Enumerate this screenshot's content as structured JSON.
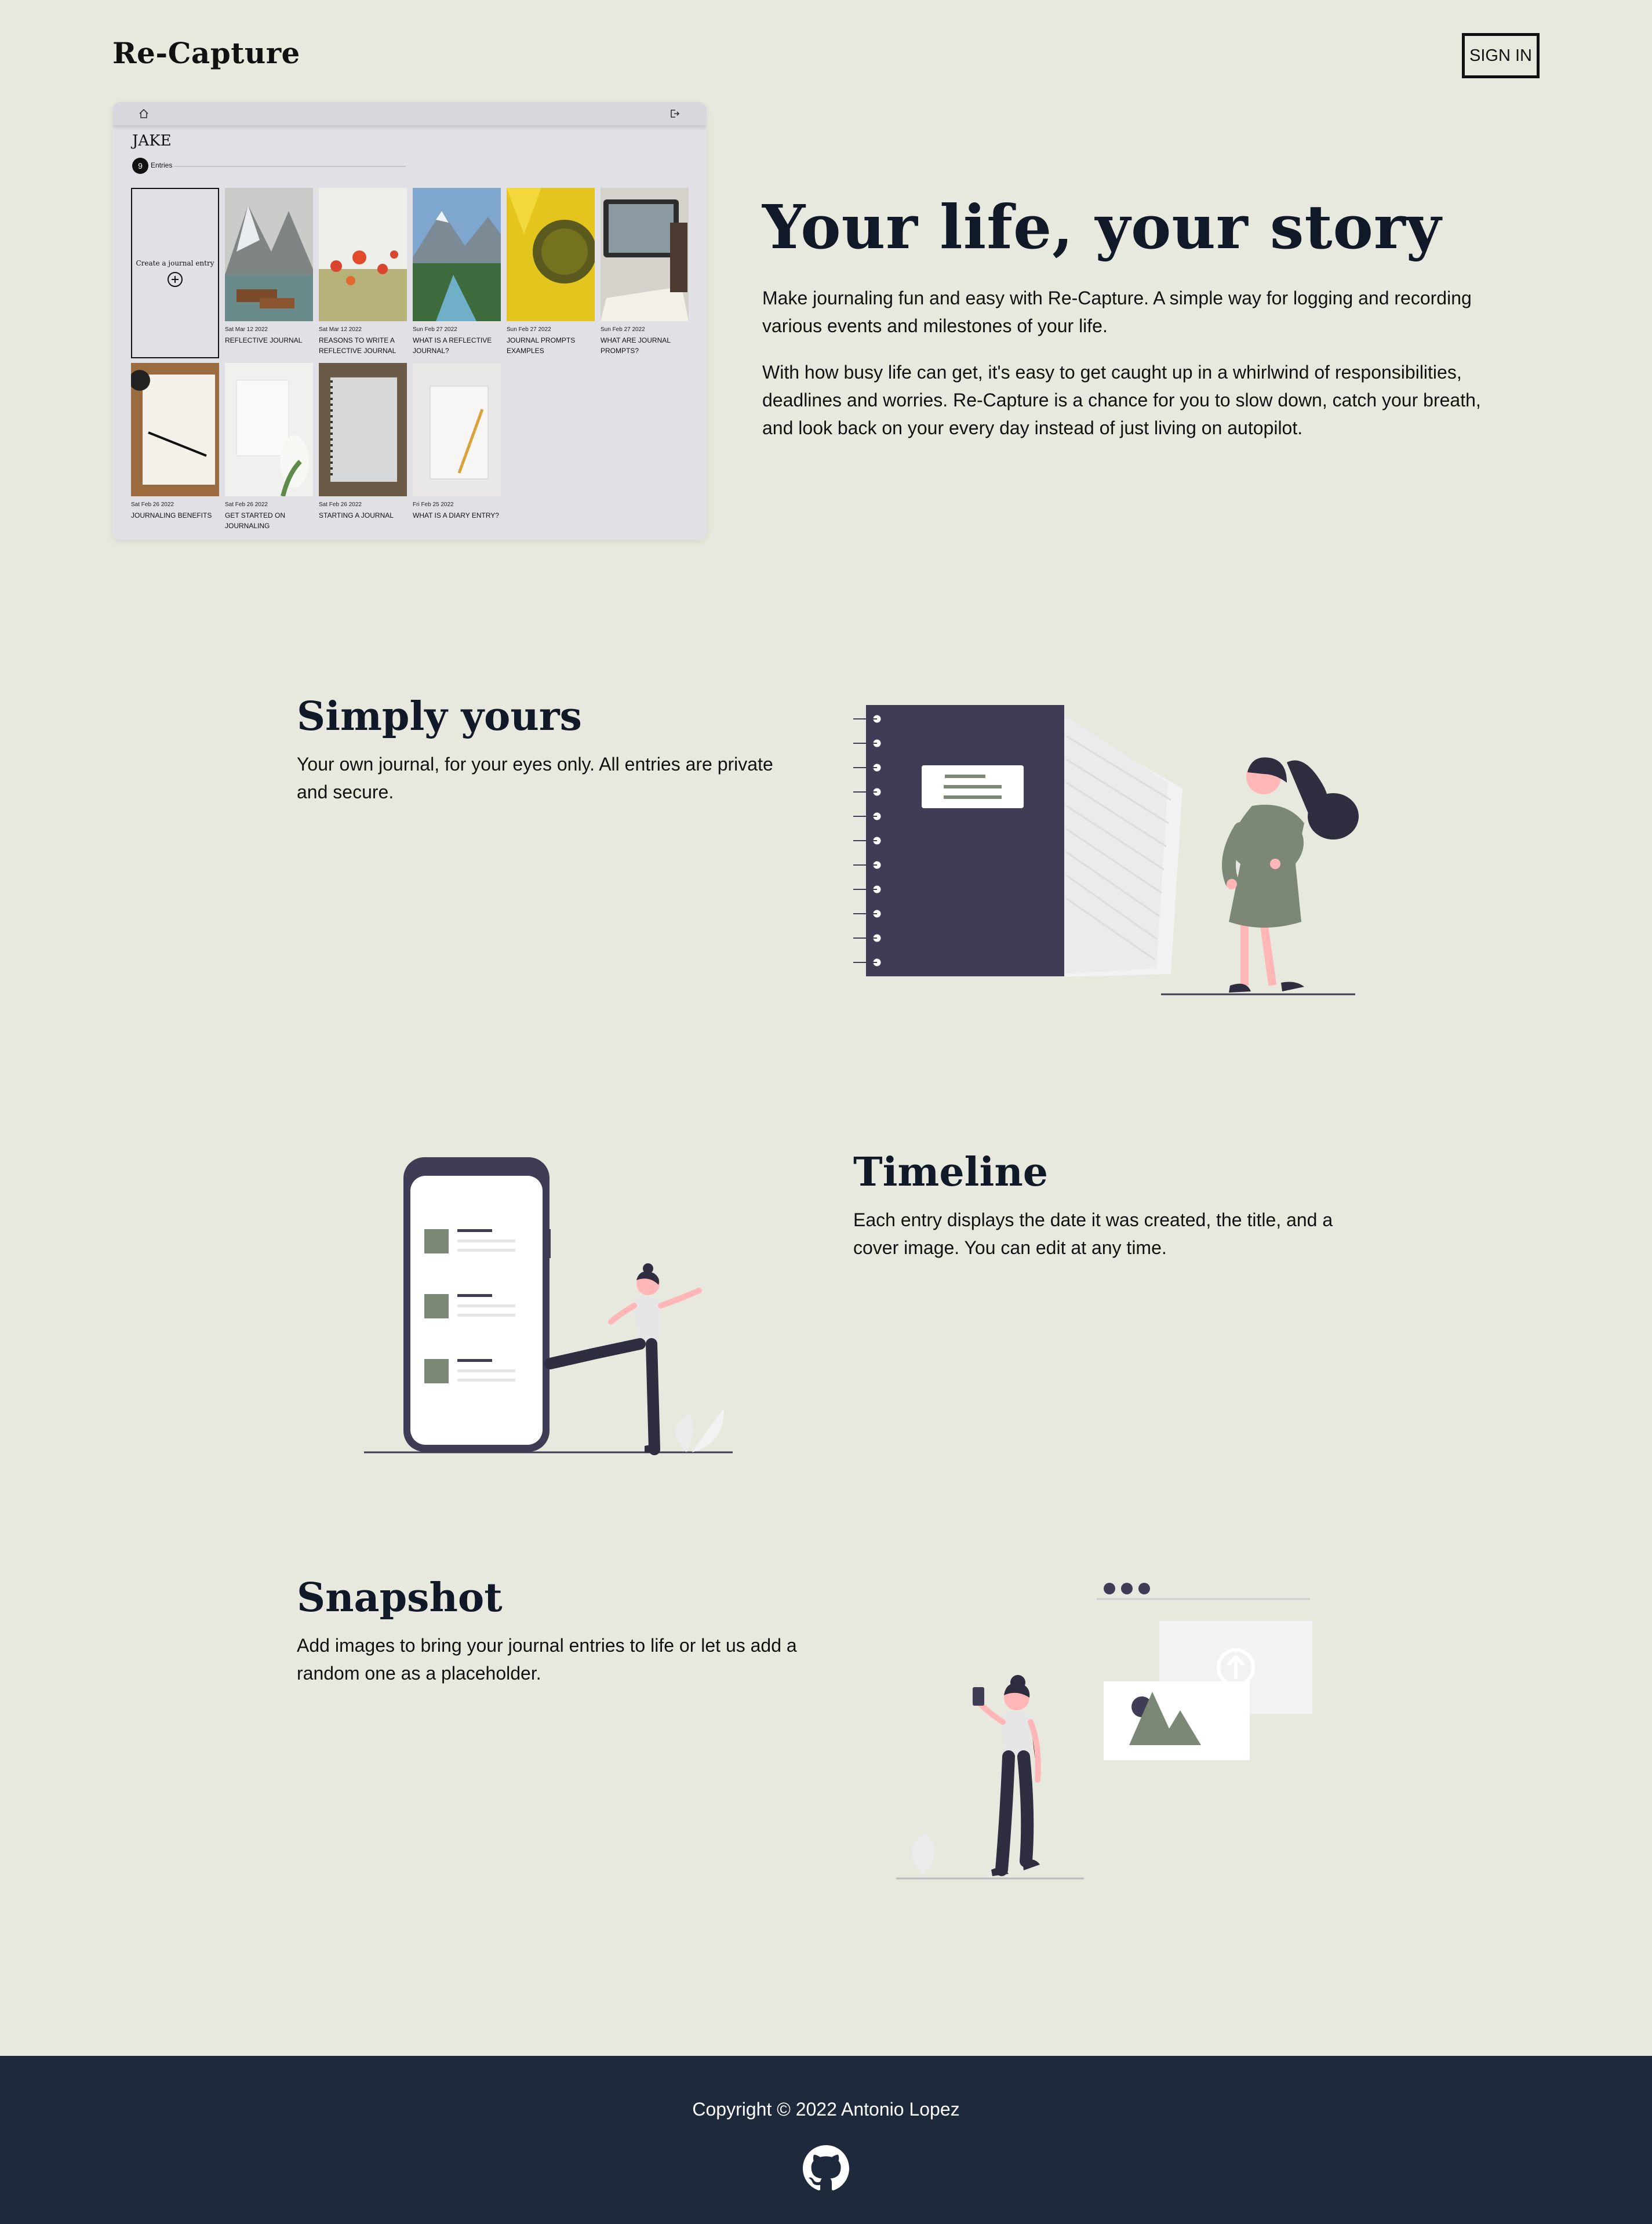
{
  "header": {
    "logo": "Re-Capture",
    "signin_label": "SIGN IN"
  },
  "preview": {
    "username": "JAKE",
    "entries_count": "9",
    "entries_label": "Entries",
    "create_label": "Create a journal entry",
    "cards": [
      {
        "date": "Sat Mar 12 2022",
        "title": "REFLECTIVE JOURNAL"
      },
      {
        "date": "Sat Mar 12 2022",
        "title": "REASONS TO WRITE A REFLECTIVE JOURNAL"
      },
      {
        "date": "Sun Feb 27 2022",
        "title": "WHAT IS A REFLECTIVE JOURNAL?"
      },
      {
        "date": "Sun Feb 27 2022",
        "title": "JOURNAL PROMPTS EXAMPLES"
      },
      {
        "date": "Sun Feb 27 2022",
        "title": "WHAT ARE JOURNAL PROMPTS?"
      },
      {
        "date": "Sat Feb 26 2022",
        "title": "JOURNALING BENEFITS"
      },
      {
        "date": "Sat Feb 26 2022",
        "title": "GET STARTED ON JOURNALING"
      },
      {
        "date": "Sat Feb 26 2022",
        "title": "STARTING A JOURNAL"
      },
      {
        "date": "Fri Feb 25 2022",
        "title": "WHAT IS A DIARY ENTRY?"
      }
    ]
  },
  "hero": {
    "title": "Your life, your story",
    "p1": "Make journaling fun and easy with Re-Capture. A simple way for logging and recording various events and milestones of your life.",
    "p2": "With how busy life can get, it's easy to get caught up in a whirlwind of responsibilities, deadlines and worries. Re-Capture is a chance for you to slow down, catch your breath, and look back on your every day instead of just living on autopilot."
  },
  "features": [
    {
      "title": "Simply yours",
      "text": "Your own journal, for your eyes only. All entries are private and secure."
    },
    {
      "title": "Timeline",
      "text": "Each entry displays the date it was created, the title, and a cover image. You can edit at any time."
    },
    {
      "title": "Snapshot",
      "text": "Add images to bring your journal entries to life or let us add a random one as a placeholder."
    }
  ],
  "footer": {
    "copyright": "Copyright © 2022 Antonio Lopez"
  },
  "colors": {
    "background": "#e8e9de",
    "footer": "#1e293b",
    "dark_purple": "#3f3d56",
    "accent_green": "#7c8776",
    "skin": "#ffb6b6"
  },
  "icons": [
    "home-icon",
    "logout-icon",
    "add-circle-icon",
    "github-icon"
  ]
}
